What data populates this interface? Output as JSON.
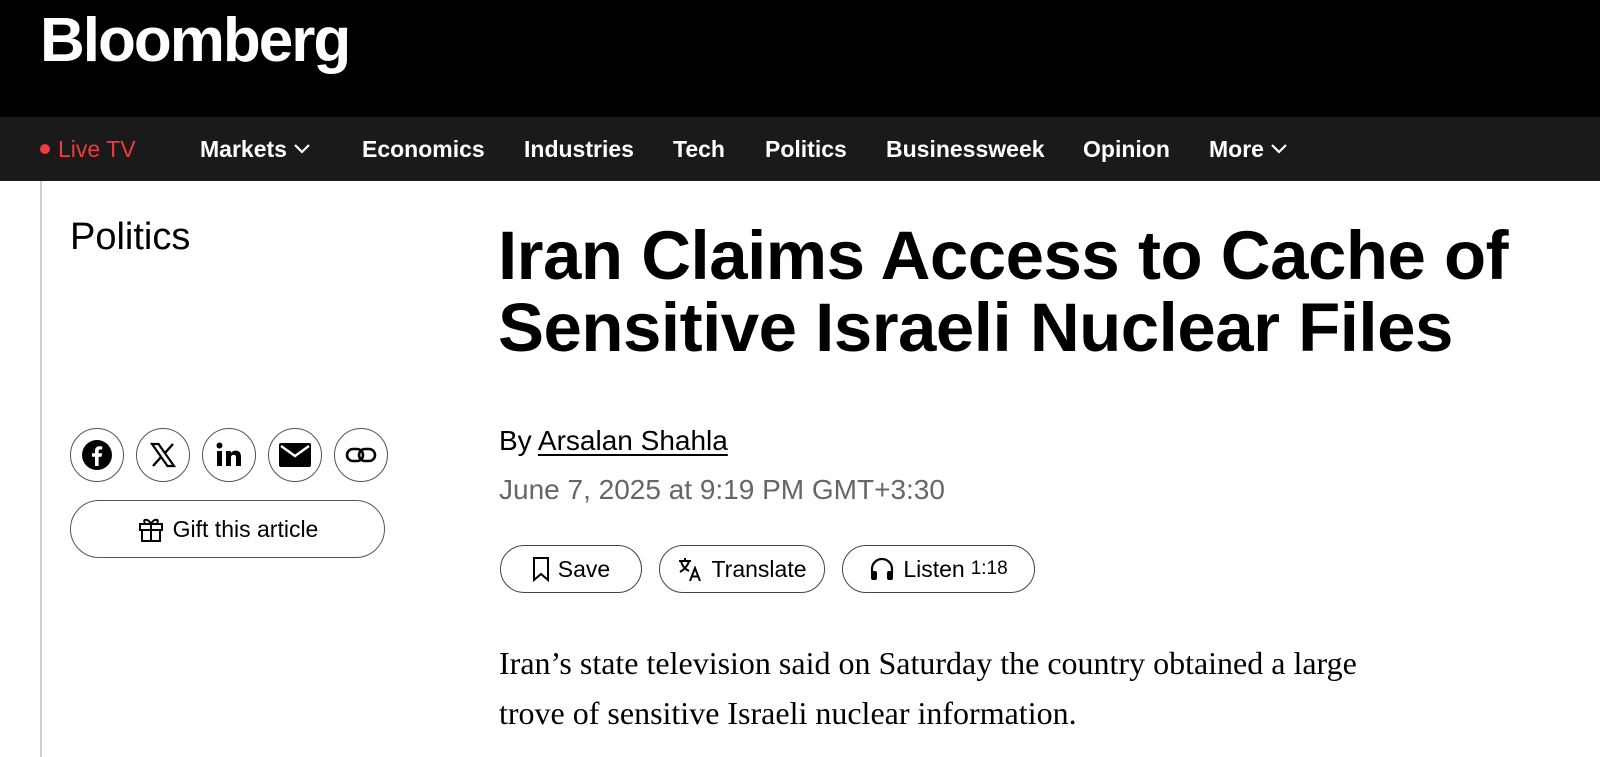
{
  "header": {
    "logo_text": "Bloomberg"
  },
  "nav": {
    "live": "Live TV",
    "items": [
      "Markets",
      "Economics",
      "Industries",
      "Tech",
      "Politics",
      "Businessweek",
      "Opinion",
      "More"
    ]
  },
  "article": {
    "section": "Politics",
    "headline_line1": "Iran Claims Access to Cache of",
    "headline_line2": "Sensitive Israeli Nuclear Files",
    "by_prefix": "By",
    "author": "Arsalan Shahla",
    "date": "June 7, 2025 at 9:19 PM GMT+3:30",
    "lede_line1": "Iran’s state television said on Saturday the country obtained a large",
    "lede_line2": "trove of sensitive Israeli nuclear information."
  },
  "actions": {
    "save": "Save",
    "translate": "Translate",
    "listen": "Listen",
    "listen_duration": "1:18",
    "gift": "Gift this article"
  },
  "share_icons": [
    "facebook-icon",
    "x-icon",
    "linkedin-icon",
    "email-icon",
    "link-icon"
  ],
  "colors": {
    "header_bg": "#000000",
    "nav_bg": "#1a1a1a",
    "live_red": "#f03b3b",
    "date_gray": "#666666"
  }
}
